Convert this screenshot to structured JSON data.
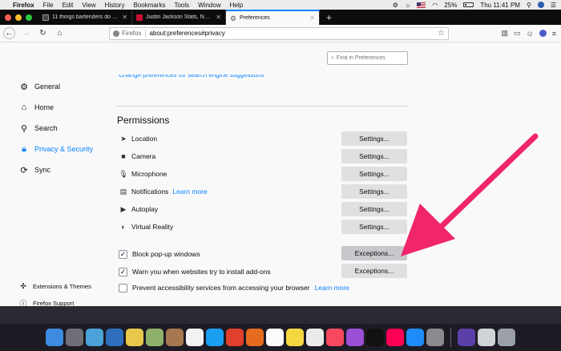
{
  "menubar": {
    "app_name": "Firefox",
    "items": [
      "File",
      "Edit",
      "View",
      "History",
      "Bookmarks",
      "Tools",
      "Window",
      "Help"
    ],
    "battery": "25%",
    "clock": "Thu 11:41 PM"
  },
  "tabs": [
    {
      "title": "11 things bartenders do that m"
    },
    {
      "title": "Justin Jackson Stats, News, Bi"
    },
    {
      "title": "Preferences"
    }
  ],
  "urlbar": {
    "identity_label": "Firefox",
    "url": "about:preferences#privacy"
  },
  "search": {
    "placeholder": "Find in Preferences"
  },
  "sidebar": {
    "items": [
      {
        "label": "General",
        "icon": "gear-icon"
      },
      {
        "label": "Home",
        "icon": "home-icon"
      },
      {
        "label": "Search",
        "icon": "search-icon"
      },
      {
        "label": "Privacy & Security",
        "icon": "lock-icon"
      },
      {
        "label": "Sync",
        "icon": "sync-icon"
      }
    ],
    "bottom": [
      {
        "label": "Extensions & Themes",
        "icon": "puzzle-icon"
      },
      {
        "label": "Firefox Support",
        "icon": "help-icon"
      }
    ]
  },
  "content": {
    "top_link": "Change preferences for search engine suggestions",
    "permissions_heading": "Permissions",
    "permissions": [
      {
        "label": "Location",
        "button": "Settings..."
      },
      {
        "label": "Camera",
        "button": "Settings..."
      },
      {
        "label": "Microphone",
        "button": "Settings..."
      },
      {
        "label": "Notifications",
        "link": "Learn more",
        "button": "Settings..."
      },
      {
        "label": "Autoplay",
        "button": "Settings..."
      },
      {
        "label": "Virtual Reality",
        "button": "Settings..."
      }
    ],
    "checkboxes": [
      {
        "label": "Block pop-up windows",
        "checked": true,
        "button": "Exceptions..."
      },
      {
        "label": "Warn you when websites try to install add-ons",
        "checked": true,
        "button": "Exceptions..."
      },
      {
        "label": "Prevent accessibility services from accessing your browser",
        "checked": false,
        "link": "Learn more"
      }
    ]
  },
  "colors": {
    "accent": "#0a84ff",
    "arrow": "#f0256b"
  }
}
